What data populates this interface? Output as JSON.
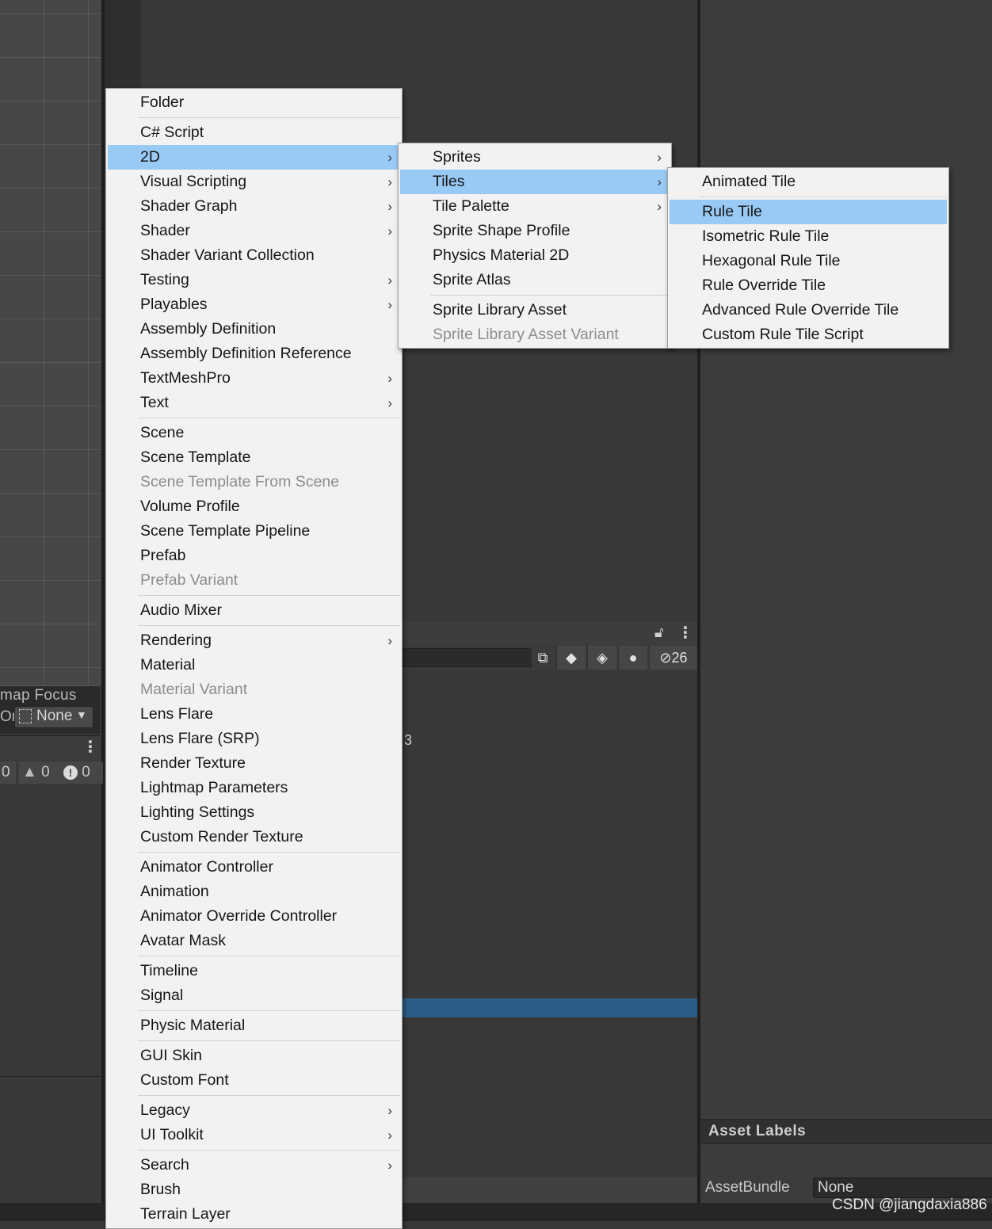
{
  "background": {
    "tilemap_focus": {
      "label": "map Focus",
      "on_label": "On",
      "dropdown_value": "None"
    },
    "console": {
      "info_count": "0",
      "warn_count": "0",
      "error_count": "0"
    },
    "project": {
      "hidden_count": "26",
      "stray_text": "3"
    },
    "inspector": {
      "asset_labels": "Asset Labels",
      "assetbundle_label": "AssetBundle",
      "assetbundle_value": "None"
    },
    "watermark": "CSDN @jiangdaxia886"
  },
  "menus": {
    "main": [
      {
        "label": "Folder"
      },
      {
        "sep": true
      },
      {
        "label": "C# Script"
      },
      {
        "label": "2D",
        "sub": true,
        "highlight": true
      },
      {
        "label": "Visual Scripting",
        "sub": true
      },
      {
        "label": "Shader Graph",
        "sub": true
      },
      {
        "label": "Shader",
        "sub": true
      },
      {
        "label": "Shader Variant Collection"
      },
      {
        "label": "Testing",
        "sub": true
      },
      {
        "label": "Playables",
        "sub": true
      },
      {
        "label": "Assembly Definition"
      },
      {
        "label": "Assembly Definition Reference"
      },
      {
        "label": "TextMeshPro",
        "sub": true
      },
      {
        "label": "Text",
        "sub": true
      },
      {
        "sep": true
      },
      {
        "label": "Scene"
      },
      {
        "label": "Scene Template"
      },
      {
        "label": "Scene Template From Scene",
        "disabled": true
      },
      {
        "label": "Volume Profile"
      },
      {
        "label": "Scene Template Pipeline"
      },
      {
        "label": "Prefab"
      },
      {
        "label": "Prefab Variant",
        "disabled": true
      },
      {
        "sep": true
      },
      {
        "label": "Audio Mixer"
      },
      {
        "sep": true
      },
      {
        "label": "Rendering",
        "sub": true
      },
      {
        "label": "Material"
      },
      {
        "label": "Material Variant",
        "disabled": true
      },
      {
        "label": "Lens Flare"
      },
      {
        "label": "Lens Flare (SRP)"
      },
      {
        "label": "Render Texture"
      },
      {
        "label": "Lightmap Parameters"
      },
      {
        "label": "Lighting Settings"
      },
      {
        "label": "Custom Render Texture"
      },
      {
        "sep": true
      },
      {
        "label": "Animator Controller"
      },
      {
        "label": "Animation"
      },
      {
        "label": "Animator Override Controller"
      },
      {
        "label": "Avatar Mask"
      },
      {
        "sep": true
      },
      {
        "label": "Timeline"
      },
      {
        "label": "Signal"
      },
      {
        "sep": true
      },
      {
        "label": "Physic Material"
      },
      {
        "sep": true
      },
      {
        "label": "GUI Skin"
      },
      {
        "label": "Custom Font"
      },
      {
        "sep": true
      },
      {
        "label": "Legacy",
        "sub": true
      },
      {
        "label": "UI Toolkit",
        "sub": true
      },
      {
        "sep": true
      },
      {
        "label": "Search",
        "sub": true
      },
      {
        "label": "Brush"
      },
      {
        "label": "Terrain Layer"
      }
    ],
    "sub_2d": [
      {
        "label": "Sprites",
        "sub": true
      },
      {
        "label": "Tiles",
        "sub": true,
        "highlight": true
      },
      {
        "label": "Tile Palette",
        "sub": true
      },
      {
        "label": "Sprite Shape Profile"
      },
      {
        "label": "Physics Material 2D"
      },
      {
        "label": "Sprite Atlas"
      },
      {
        "sep": true
      },
      {
        "label": "Sprite Library Asset"
      },
      {
        "label": "Sprite Library Asset Variant",
        "disabled": true
      }
    ],
    "sub_tiles": [
      {
        "label": "Animated Tile"
      },
      {
        "sep": true
      },
      {
        "label": "Rule Tile",
        "highlight": true
      },
      {
        "label": "Isometric Rule Tile"
      },
      {
        "label": "Hexagonal Rule Tile"
      },
      {
        "label": "Rule Override Tile"
      },
      {
        "label": "Advanced Rule Override Tile"
      },
      {
        "label": "Custom Rule Tile Script"
      }
    ]
  },
  "colors": {
    "menu_bg": "#f2f2f2",
    "menu_highlight": "#99c9f5",
    "menu_disabled_text": "#8c8c8c",
    "editor_bg": "#383838",
    "project_selection": "#2c5d87"
  },
  "icons": {
    "submenu_arrow": "›",
    "lock": "lock-icon",
    "kebab": "kebab-menu-icon",
    "warning": "warning-icon",
    "error": "error-icon",
    "eye_hidden": "eye-slash-icon"
  }
}
